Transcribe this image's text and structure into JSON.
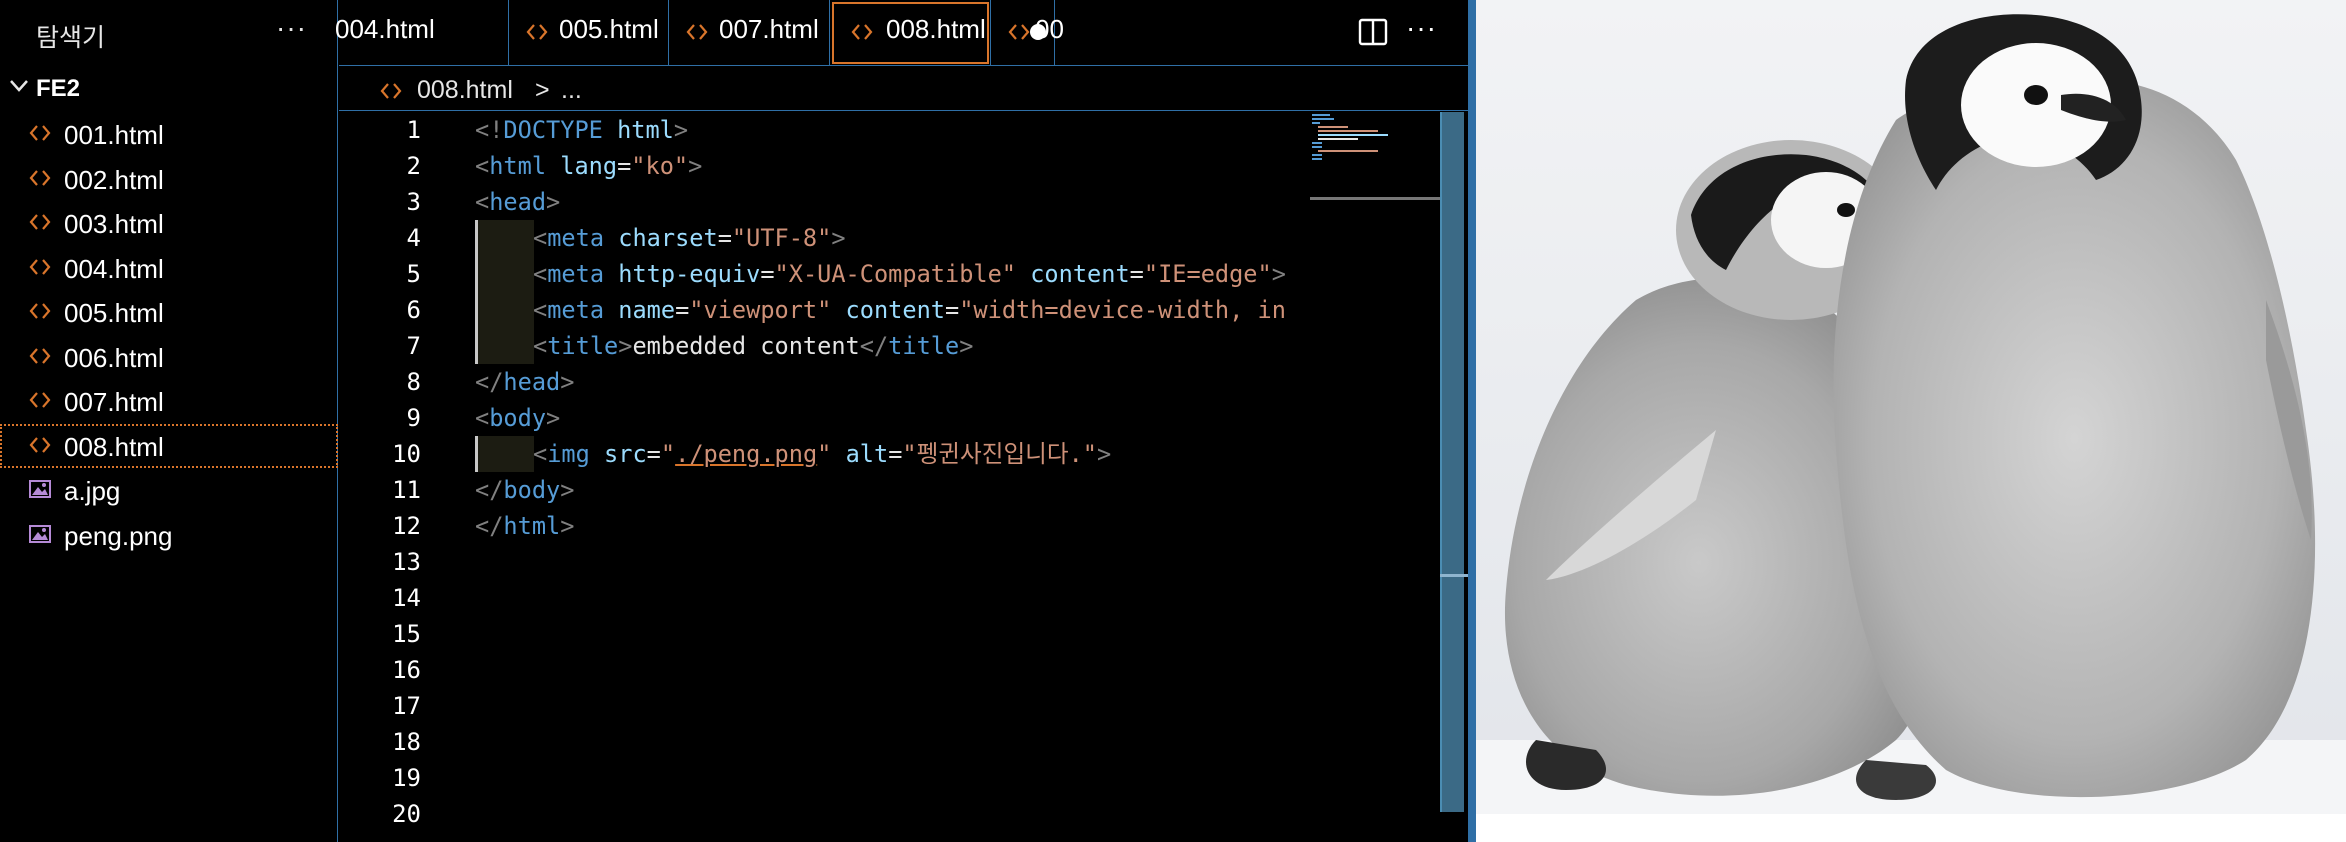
{
  "sidebar": {
    "title": "탐색기",
    "more_icon": "ellipsis-icon",
    "folder": "FE2",
    "files": [
      {
        "name": "001.html",
        "icon": "html-icon"
      },
      {
        "name": "002.html",
        "icon": "html-icon"
      },
      {
        "name": "003.html",
        "icon": "html-icon"
      },
      {
        "name": "004.html",
        "icon": "html-icon"
      },
      {
        "name": "005.html",
        "icon": "html-icon"
      },
      {
        "name": "006.html",
        "icon": "html-icon"
      },
      {
        "name": "007.html",
        "icon": "html-icon"
      },
      {
        "name": "008.html",
        "icon": "html-icon",
        "selected": true
      },
      {
        "name": "a.jpg",
        "icon": "image-icon"
      },
      {
        "name": "peng.png",
        "icon": "image-icon"
      }
    ]
  },
  "tabs": [
    {
      "label": "004.html"
    },
    {
      "label": "005.html"
    },
    {
      "label": "007.html"
    },
    {
      "label": "008.html",
      "active": true,
      "dirty": true
    },
    {
      "label": "00"
    }
  ],
  "breadcrumb": {
    "file": "008.html",
    "separator": ">",
    "more": "..."
  },
  "line_numbers": [
    "1",
    "2",
    "3",
    "4",
    "5",
    "6",
    "7",
    "8",
    "9",
    "10",
    "11",
    "12",
    "13",
    "14",
    "15",
    "16",
    "17",
    "18",
    "19",
    "20"
  ],
  "code": {
    "l1": {
      "open": "<!",
      "tag": "DOCTYPE",
      "attr": " html",
      "close": ">"
    },
    "l2": {
      "open": "<",
      "tag": "html",
      "attr": " lang",
      "eq": "=",
      "val": "\"ko\"",
      "close": ">"
    },
    "l3": {
      "open": "<",
      "tag": "head",
      "close": ">"
    },
    "l4": {
      "open": "<",
      "tag": "meta",
      "attr": " charset",
      "eq": "=",
      "val": "\"UTF-8\"",
      "close": ">"
    },
    "l5": {
      "open": "<",
      "tag": "meta",
      "attr1": " http-equiv",
      "eq1": "=",
      "val1": "\"X-UA-Compatible\"",
      "attr2": " content",
      "eq2": "=",
      "val2": "\"IE=edge\"",
      "close": ">"
    },
    "l6": {
      "open": "<",
      "tag": "meta",
      "attr1": " name",
      "eq1": "=",
      "val1": "\"viewport\"",
      "attr2": " content",
      "eq2": "=",
      "val2": "\"width=device-width, in"
    },
    "l7": {
      "open": "<",
      "tag": "title",
      "close": ">",
      "text": "embedded content",
      "endopen": "</",
      "endtag": "title",
      "endclose": ">"
    },
    "l8": {
      "open": "</",
      "tag": "head",
      "close": ">"
    },
    "l9": {
      "open": "<",
      "tag": "body",
      "close": ">"
    },
    "l10": {
      "open": "<",
      "tag": "img",
      "attr1": " src",
      "eq1": "=",
      "q1": "\"",
      "link": "./peng.png",
      "q2": "\"",
      "attr2": " alt",
      "eq2": "=",
      "val2": "\"펭귄사진입니다.\"",
      "close": ">"
    },
    "l11": {
      "open": "</",
      "tag": "body",
      "close": ">"
    },
    "l12": {
      "open": "</",
      "tag": "html",
      "close": ">"
    }
  },
  "preview": {
    "image_subject": "two emperor penguin chicks on snow"
  },
  "colors": {
    "accent_orange": "#d9752b",
    "border_blue": "#2f6fa6",
    "tag_blue": "#569cd6",
    "attr_lightblue": "#9cdcfe",
    "string_orange": "#ce9178"
  }
}
